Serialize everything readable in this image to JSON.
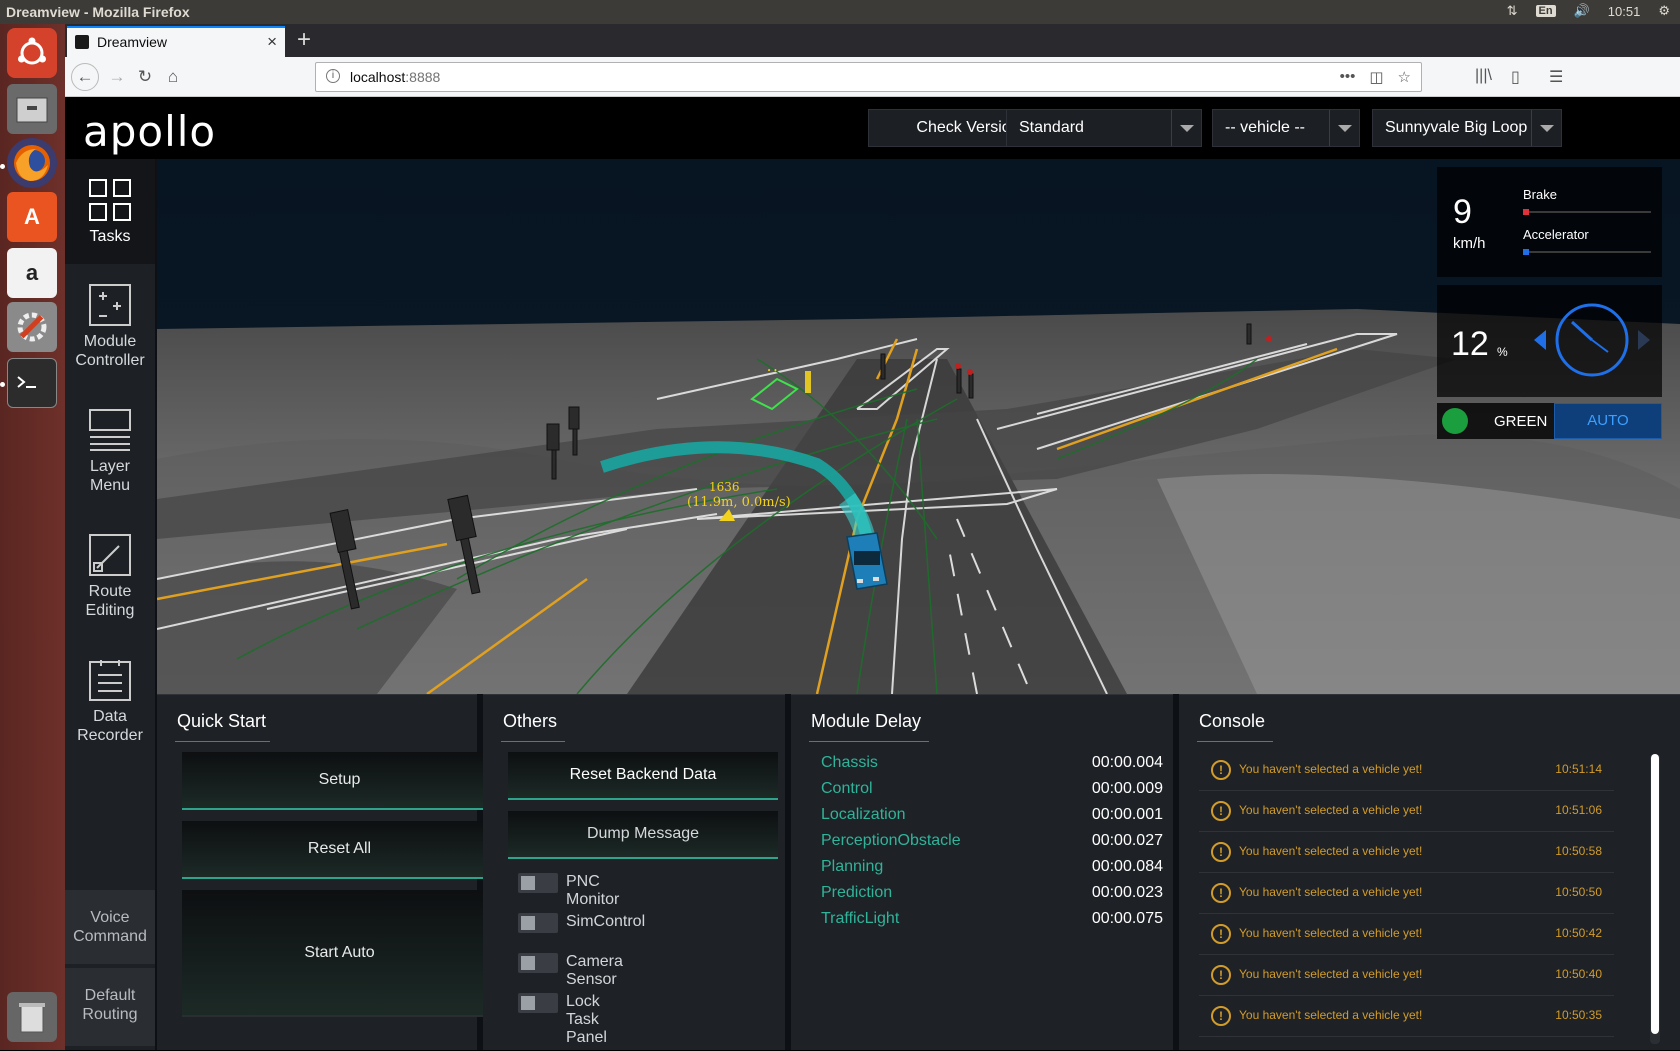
{
  "os": {
    "window_title": "Dreamview - Mozilla Firefox",
    "keyboard_layout": "En",
    "clock": "10:51"
  },
  "browser": {
    "tab_title": "Dreamview",
    "url_host": "localhost",
    "url_port": ":8888",
    "new_tab": "+",
    "close_tab": "×"
  },
  "header": {
    "logo": "apollo",
    "check_version": "Check Version",
    "mode_select": "Standard",
    "vehicle_select": "-- vehicle --",
    "map_select": "Sunnyvale Big Loop"
  },
  "sidebar": {
    "items": [
      {
        "label_1": "Tasks",
        "label_2": ""
      },
      {
        "label_1": "Module",
        "label_2": "Controller"
      },
      {
        "label_1": "Layer",
        "label_2": "Menu"
      },
      {
        "label_1": "Route",
        "label_2": "Editing"
      },
      {
        "label_1": "Data",
        "label_2": "Recorder"
      }
    ],
    "bottom": [
      {
        "label_1": "Voice",
        "label_2": "Command"
      },
      {
        "label_1": "Default",
        "label_2": "Routing"
      }
    ]
  },
  "scene": {
    "obstacle_id": "1636",
    "obstacle_info": "(11.9m, 0.0m/s)"
  },
  "dashboard": {
    "speed": "9",
    "speed_unit": "km/h",
    "brake_label": "Brake",
    "accelerator_label": "Accelerator",
    "brake_level": 0.03,
    "accelerator_level": 0.03,
    "steering": "12",
    "steering_unit": "%",
    "traffic_light": "GREEN",
    "drive_mode": "AUTO",
    "colors": {
      "green": "#1b9e3d",
      "auto_bg": "#0e3f7a",
      "auto_text": "#3aa0ff",
      "brake": "#e0323a",
      "accelerator": "#1e6fe8"
    }
  },
  "quick_start": {
    "title": "Quick Start",
    "buttons": [
      "Setup",
      "Reset All",
      "Start Auto"
    ]
  },
  "others": {
    "title": "Others",
    "buttons": [
      "Reset Backend Data",
      "Dump Message"
    ],
    "toggles": [
      "PNC Monitor",
      "SimControl",
      "Camera Sensor",
      "Lock Task Panel"
    ]
  },
  "module_delay": {
    "title": "Module Delay",
    "rows": [
      {
        "name": "Chassis",
        "value": "00:00.004"
      },
      {
        "name": "Control",
        "value": "00:00.009"
      },
      {
        "name": "Localization",
        "value": "00:00.001"
      },
      {
        "name": "PerceptionObstacle",
        "value": "00:00.027"
      },
      {
        "name": "Planning",
        "value": "00:00.084"
      },
      {
        "name": "Prediction",
        "value": "00:00.023"
      },
      {
        "name": "TrafficLight",
        "value": "00:00.075"
      }
    ]
  },
  "console": {
    "title": "Console",
    "messages": [
      {
        "text": "You haven't selected a vehicle yet!",
        "time": "10:51:14"
      },
      {
        "text": "You haven't selected a vehicle yet!",
        "time": "10:51:06"
      },
      {
        "text": "You haven't selected a vehicle yet!",
        "time": "10:50:58"
      },
      {
        "text": "You haven't selected a vehicle yet!",
        "time": "10:50:50"
      },
      {
        "text": "You haven't selected a vehicle yet!",
        "time": "10:50:42"
      },
      {
        "text": "You haven't selected a vehicle yet!",
        "time": "10:50:40"
      },
      {
        "text": "You haven't selected a vehicle yet!",
        "time": "10:50:35"
      }
    ]
  }
}
